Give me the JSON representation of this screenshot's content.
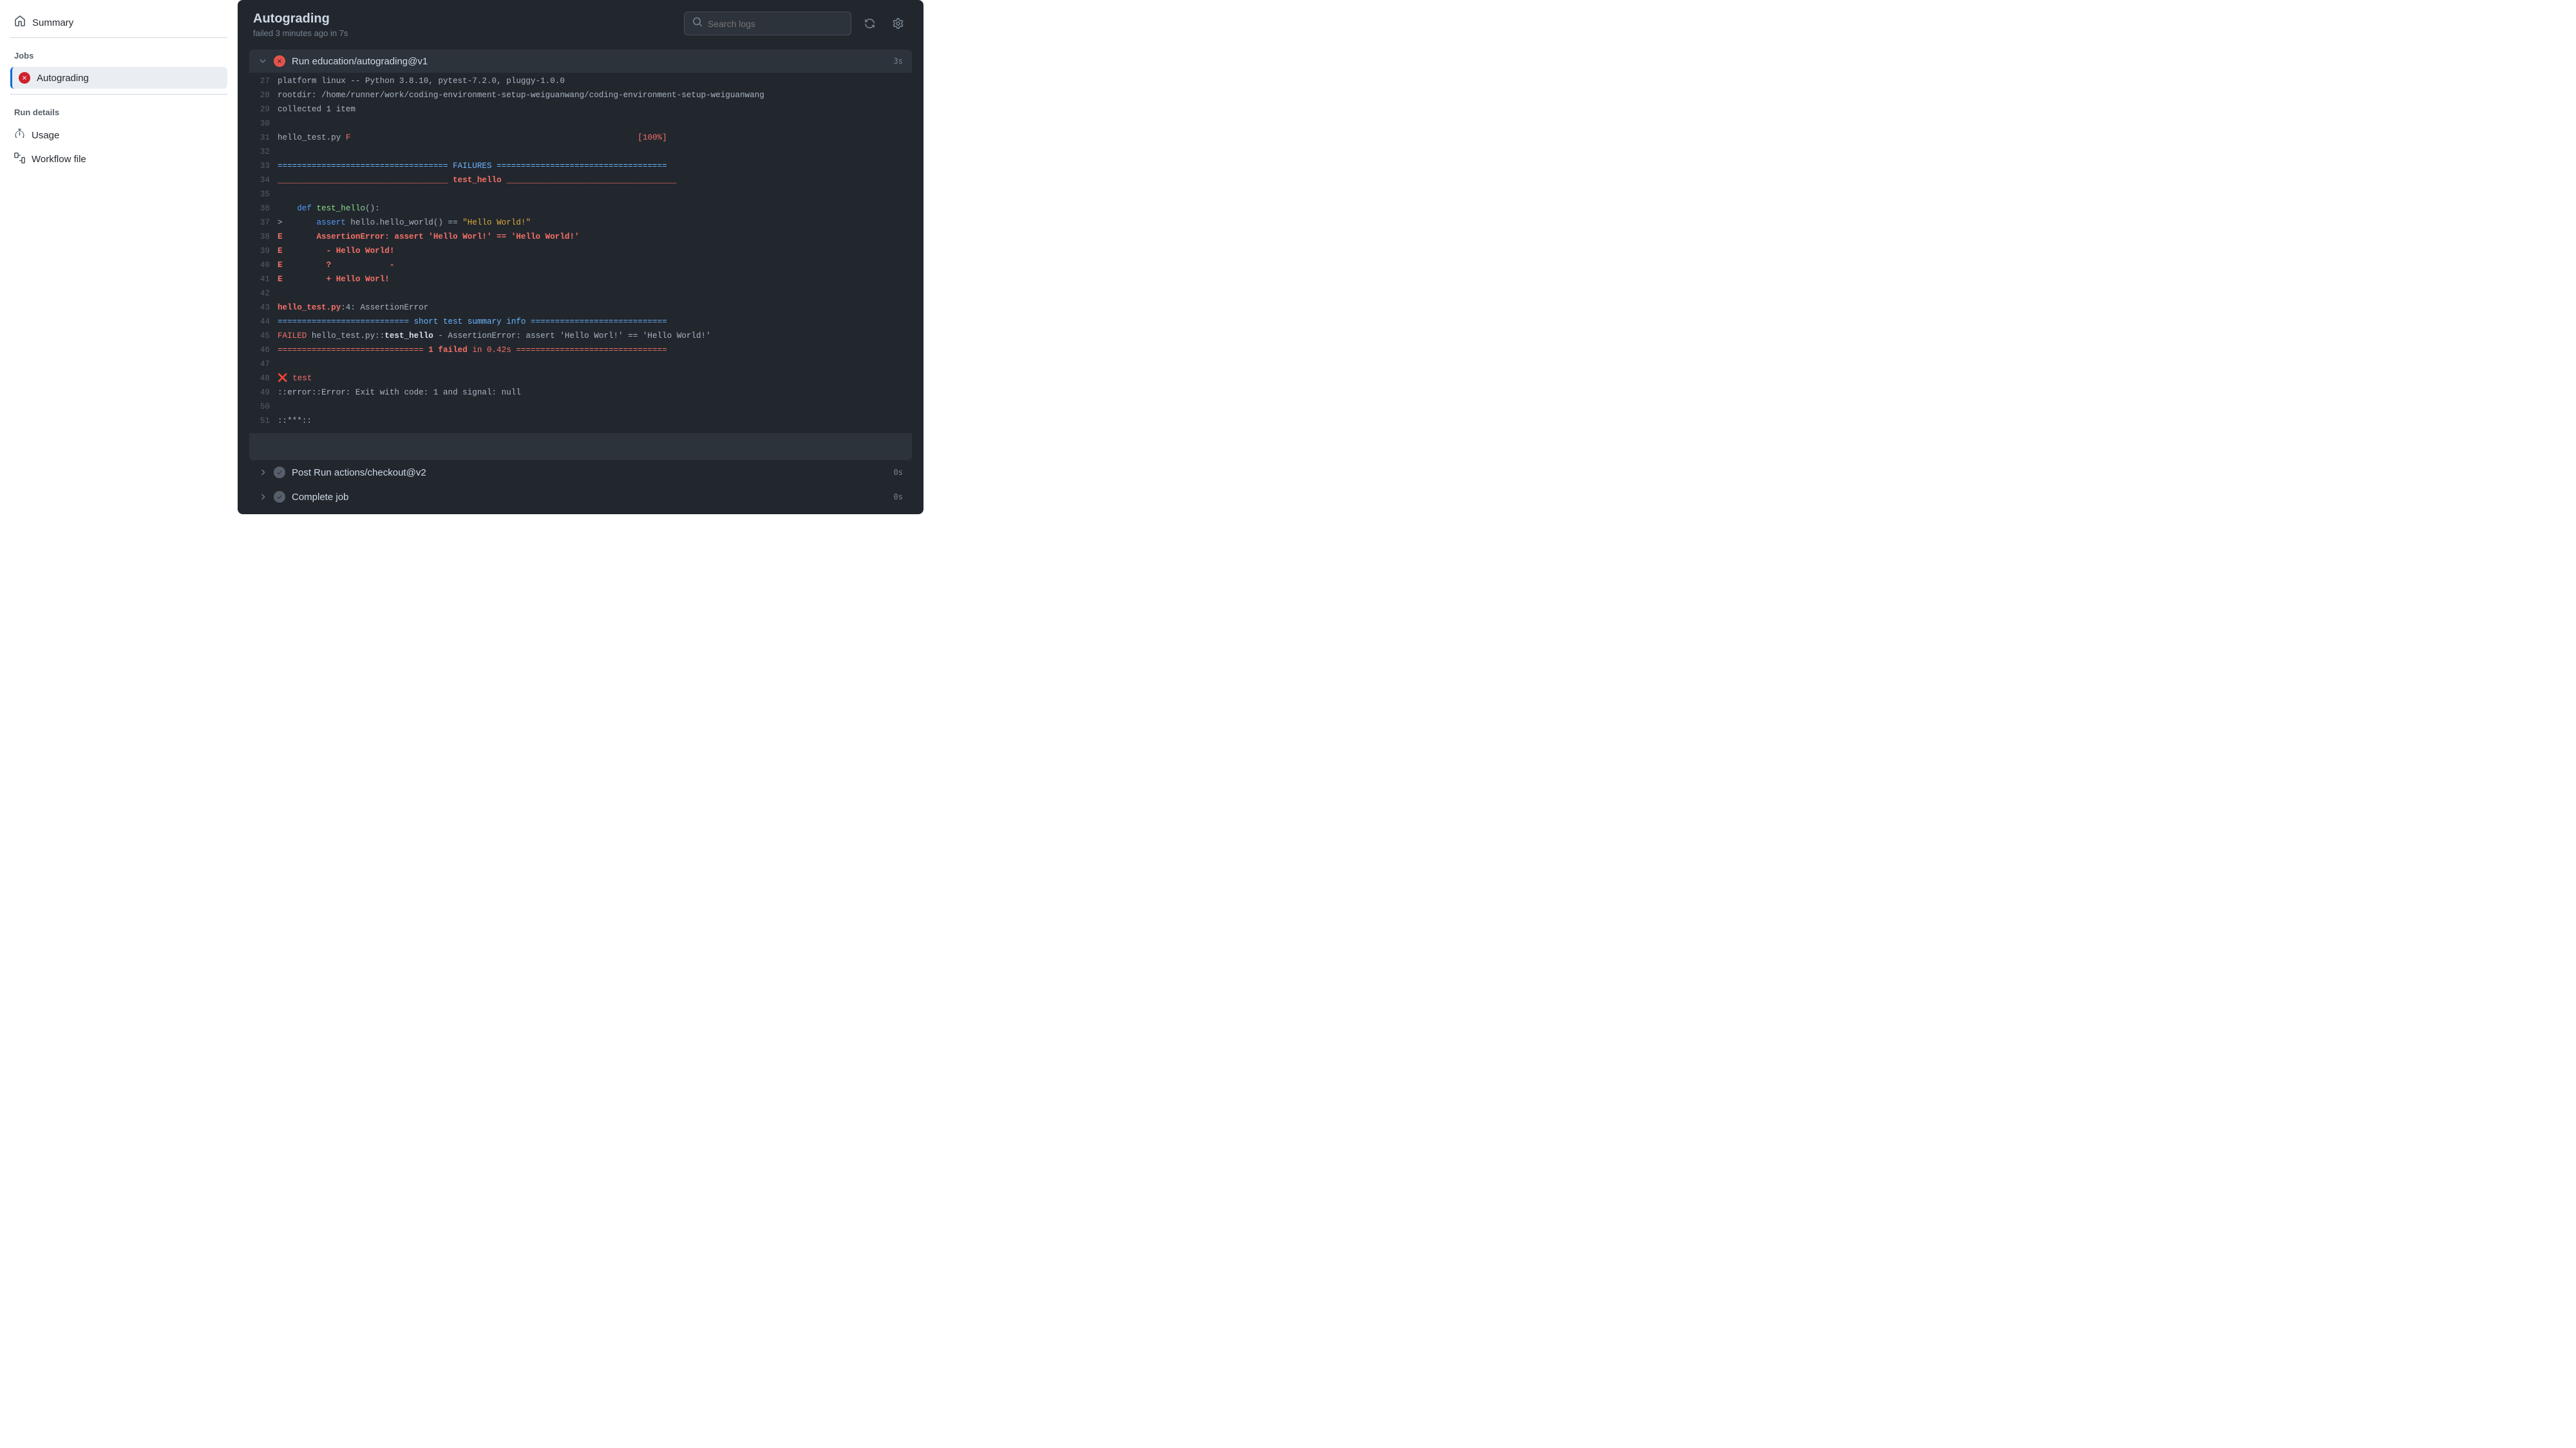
{
  "sidebar": {
    "summary_label": "Summary",
    "jobs_label": "Jobs",
    "job_name": "Autograding",
    "run_details_label": "Run details",
    "usage_label": "Usage",
    "workflow_file_label": "Workflow file"
  },
  "header": {
    "title": "Autograding",
    "subtitle": "failed 3 minutes ago in 7s",
    "search_placeholder": "Search logs"
  },
  "step_expanded": {
    "title": "Run education/autograding@v1",
    "duration": "3s"
  },
  "log_lines": [
    {
      "n": 27,
      "segs": [
        {
          "t": "platform linux -- Python 3.8.10, pytest-7.2.0, pluggy-1.0.0"
        }
      ]
    },
    {
      "n": 28,
      "segs": [
        {
          "t": "rootdir: /home/runner/work/coding-environment-setup-weiguanwang/coding-environment-setup-weiguanwang"
        }
      ]
    },
    {
      "n": 29,
      "segs": [
        {
          "t": "collected 1 item"
        }
      ]
    },
    {
      "n": 30,
      "segs": [
        {
          "t": ""
        }
      ]
    },
    {
      "n": 31,
      "segs": [
        {
          "t": "hello_test.py "
        },
        {
          "t": "F",
          "c": "c-red"
        },
        {
          "t": "                                                           "
        },
        {
          "t": "[100%]",
          "c": "c-red"
        }
      ]
    },
    {
      "n": 32,
      "segs": [
        {
          "t": ""
        }
      ]
    },
    {
      "n": 33,
      "segs": [
        {
          "t": "=================================== FAILURES ===================================",
          "c": "c-cyan"
        }
      ]
    },
    {
      "n": 34,
      "segs": [
        {
          "t": "___________________________________ ",
          "c": "c-redb"
        },
        {
          "t": "test_hello",
          "c": "c-redb"
        },
        {
          "t": " ___________________________________",
          "c": "c-redb"
        }
      ]
    },
    {
      "n": 35,
      "segs": [
        {
          "t": ""
        }
      ]
    },
    {
      "n": 36,
      "segs": [
        {
          "t": "    "
        },
        {
          "t": "def",
          "c": "c-blue"
        },
        {
          "t": " "
        },
        {
          "t": "test_hello",
          "c": "c-grn"
        },
        {
          "t": "():"
        }
      ]
    },
    {
      "n": 37,
      "segs": [
        {
          "t": ">       "
        },
        {
          "t": "assert",
          "c": "c-blue"
        },
        {
          "t": " hello.hello_world() == "
        },
        {
          "t": "\"Hello World!\"",
          "c": "c-yel"
        }
      ]
    },
    {
      "n": 38,
      "segs": [
        {
          "t": "E       ",
          "c": "c-redb"
        },
        {
          "t": "AssertionError: assert 'Hello Worl!' == 'Hello World!'",
          "c": "c-redb"
        }
      ]
    },
    {
      "n": 39,
      "segs": [
        {
          "t": "E         ",
          "c": "c-redb"
        },
        {
          "t": "- Hello World!",
          "c": "c-redb"
        }
      ]
    },
    {
      "n": 40,
      "segs": [
        {
          "t": "E         ",
          "c": "c-redb"
        },
        {
          "t": "?            -",
          "c": "c-redb"
        }
      ]
    },
    {
      "n": 41,
      "segs": [
        {
          "t": "E         ",
          "c": "c-redb"
        },
        {
          "t": "+ Hello Worl!",
          "c": "c-redb"
        }
      ]
    },
    {
      "n": 42,
      "segs": [
        {
          "t": ""
        }
      ]
    },
    {
      "n": 43,
      "segs": [
        {
          "t": "hello_test.py",
          "c": "c-redb"
        },
        {
          "t": ":4: AssertionError"
        }
      ]
    },
    {
      "n": 44,
      "segs": [
        {
          "t": "=========================== ",
          "c": "c-cyan"
        },
        {
          "t": "short test summary info",
          "c": "c-cyan"
        },
        {
          "t": " ============================",
          "c": "c-cyan"
        }
      ]
    },
    {
      "n": 45,
      "segs": [
        {
          "t": "FAILED",
          "c": "c-red"
        },
        {
          "t": " hello_test.py::"
        },
        {
          "t": "test_hello",
          "c": "c-whiteb"
        },
        {
          "t": " - AssertionError: assert 'Hello Worl!' == 'Hello World!'"
        }
      ]
    },
    {
      "n": 46,
      "segs": [
        {
          "t": "============================== ",
          "c": "c-red"
        },
        {
          "t": "1 failed",
          "c": "c-redb"
        },
        {
          "t": " in 0.42s",
          "c": "c-red"
        },
        {
          "t": " ===============================",
          "c": "c-red"
        }
      ]
    },
    {
      "n": 47,
      "segs": [
        {
          "t": ""
        }
      ]
    },
    {
      "n": 48,
      "segs": [
        {
          "t": "❌ ",
          "c": "c-red-bright"
        },
        {
          "t": "test",
          "c": "c-red"
        }
      ]
    },
    {
      "n": 49,
      "segs": [
        {
          "t": "::error::Error: Exit with code: 1 and signal: null"
        }
      ]
    },
    {
      "n": 50,
      "segs": [
        {
          "t": ""
        }
      ]
    },
    {
      "n": 51,
      "segs": [
        {
          "t": "::"
        },
        {
          "t": "***"
        },
        {
          "t": "::"
        }
      ]
    }
  ],
  "collapsed_steps": [
    {
      "title": "Post Run actions/checkout@v2",
      "duration": "0s"
    },
    {
      "title": "Complete job",
      "duration": "0s"
    }
  ]
}
